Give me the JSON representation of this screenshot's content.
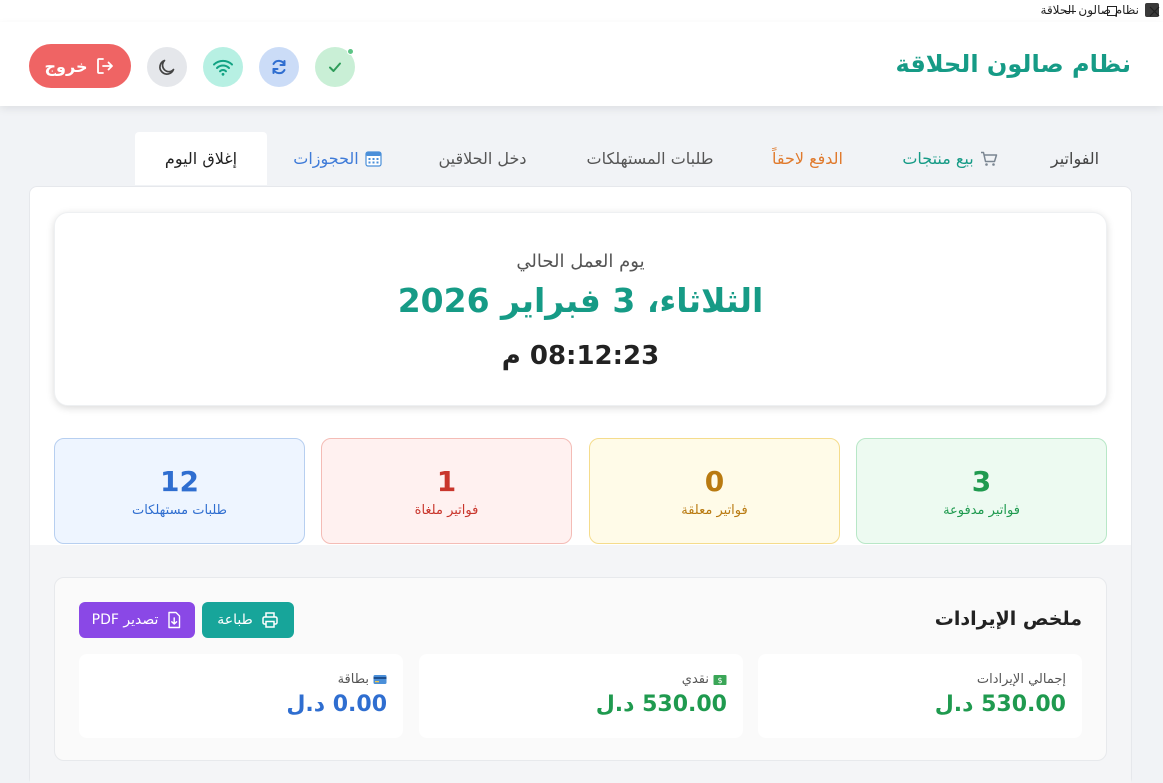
{
  "window": {
    "title": "نظام صالون الحلاقة"
  },
  "header": {
    "app_name": "نظام صالون الحلاقة",
    "logout_label": "خروج"
  },
  "tabs": [
    {
      "label": "الفواتير",
      "icon": "none"
    },
    {
      "label": "بيع منتجات",
      "icon": "cart-icon"
    },
    {
      "label": "الدفع لاحقاً",
      "icon": "none"
    },
    {
      "label": "طلبات المستهلكات",
      "icon": "none"
    },
    {
      "label": "دخل الحلاقين",
      "icon": "none"
    },
    {
      "label": "الحجوزات",
      "icon": "calendar-icon"
    },
    {
      "label": "إغلاق اليوم",
      "icon": "none",
      "active": true
    }
  ],
  "workday": {
    "label": "يوم العمل الحالي",
    "date": "الثلاثاء، 3 فبراير 2026",
    "time": "08:12:23 م"
  },
  "stats": {
    "paid": {
      "value": "3",
      "label": "فواتير مدفوعة"
    },
    "pending": {
      "value": "0",
      "label": "فواتير معلقة"
    },
    "cancelled": {
      "value": "1",
      "label": "فواتير ملغاة"
    },
    "consumables": {
      "value": "12",
      "label": "طلبات مستهلكات"
    }
  },
  "revenue": {
    "title": "ملخص الإيرادات",
    "print_label": "طباعة",
    "pdf_label": "تصدير PDF",
    "total": {
      "label": "إجمالي الإيرادات",
      "value": "530.00 د.ل"
    },
    "cash": {
      "label": "نقدي",
      "value": "530.00 د.ل"
    },
    "card": {
      "label": "بطاقة",
      "value": "0.00 د.ل"
    }
  },
  "colors": {
    "brand": "#169b86",
    "logout": "#ef6464",
    "paid": "#1f9a4f",
    "pending": "#b97a10",
    "cancelled": "#c9362c",
    "consumables": "#2f6ed0"
  }
}
